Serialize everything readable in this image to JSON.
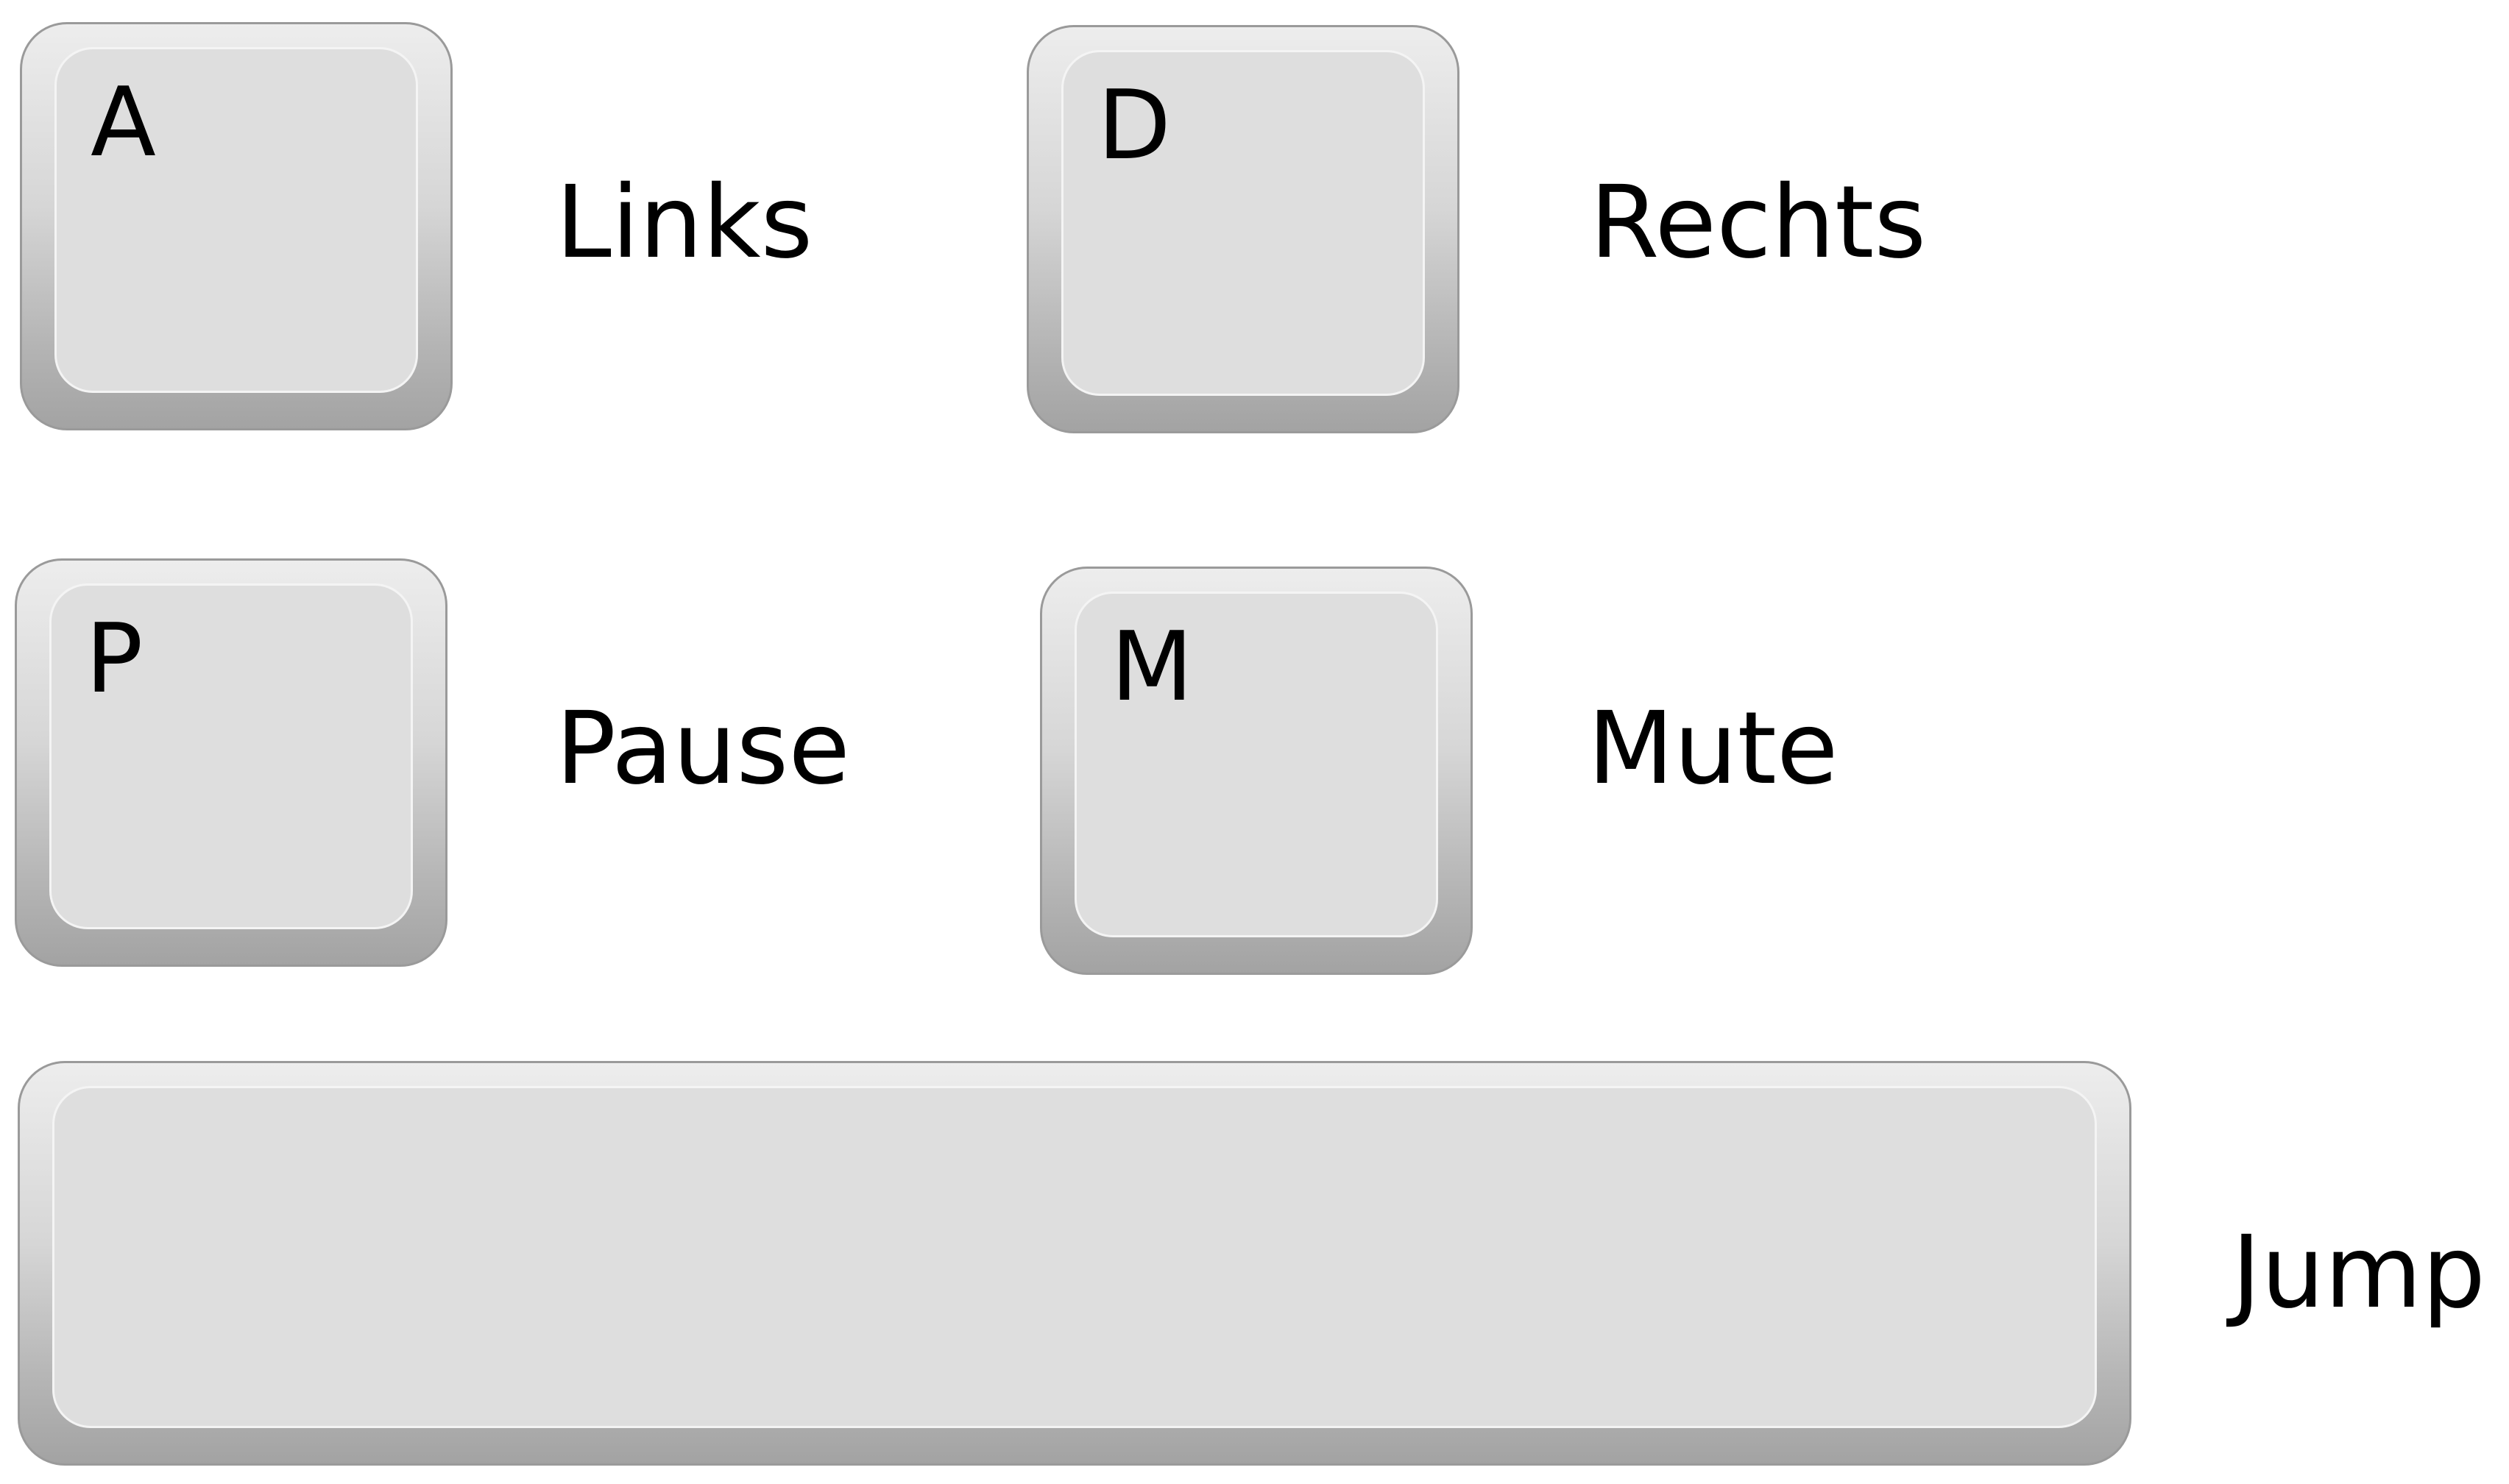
{
  "keys": [
    {
      "letter": "A",
      "action": "Links"
    },
    {
      "letter": "D",
      "action": "Rechts"
    },
    {
      "letter": "P",
      "action": "Pause"
    },
    {
      "letter": "M",
      "action": "Mute"
    },
    {
      "letter": "",
      "action": "Jump"
    }
  ],
  "colors": {
    "key_face": "#dedede",
    "key_edge": "#a3a3a3",
    "background": "#ffffff",
    "text": "#000000"
  }
}
